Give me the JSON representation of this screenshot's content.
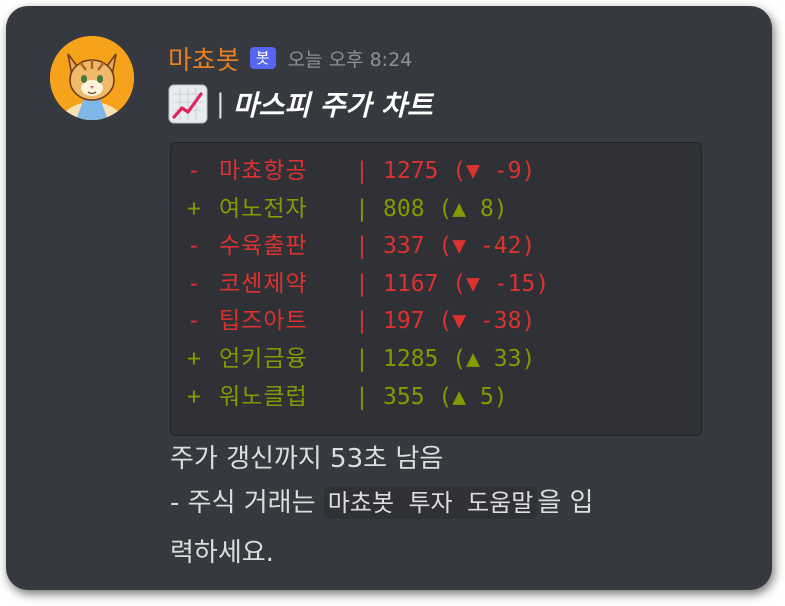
{
  "message": {
    "author": {
      "username": "마쵸봇",
      "badge": "봇",
      "timestamp": "오늘 오후 8:24",
      "avatar_icon": "cat-avatar-icon"
    },
    "title": {
      "emoji": "chart-increasing-icon",
      "separator": "|",
      "text": "마스피 주가 차트"
    },
    "stocks": [
      {
        "sign": "-",
        "name": "마쵸항공",
        "sep": "|",
        "price": "1275",
        "change": "(▼ -9)",
        "direction": "down"
      },
      {
        "sign": "+",
        "name": "여노전자",
        "sep": "|",
        "price": "808",
        "change": "(▲ 8)",
        "direction": "up"
      },
      {
        "sign": "-",
        "name": "수육출판",
        "sep": "|",
        "price": "337",
        "change": "(▼ -42)",
        "direction": "down"
      },
      {
        "sign": "-",
        "name": "코센제약",
        "sep": "|",
        "price": "1167",
        "change": "(▼ -15)",
        "direction": "down"
      },
      {
        "sign": "-",
        "name": "팁즈아트",
        "sep": "|",
        "price": "197",
        "change": "(▼ -38)",
        "direction": "down"
      },
      {
        "sign": "+",
        "name": "언키금융",
        "sep": "|",
        "price": "1285",
        "change": "(▲ 33)",
        "direction": "up"
      },
      {
        "sign": "+",
        "name": "워노클럽",
        "sep": "|",
        "price": "355",
        "change": "(▲ 5)",
        "direction": "up"
      }
    ],
    "countdown": "주가 갱신까지 53초 남음",
    "hint": {
      "prefix": " - 주식 거래는 ",
      "command": "마쵸봇 투자 도움말",
      "suffix": "을 입",
      "line2": "력하세요."
    }
  },
  "colors": {
    "background": "#36393f",
    "codeblock": "#2f3136",
    "username": "#e67e22",
    "badge": "#5865f2",
    "down": "#dc322f",
    "up": "#859900",
    "timestamp": "#8e9297"
  }
}
